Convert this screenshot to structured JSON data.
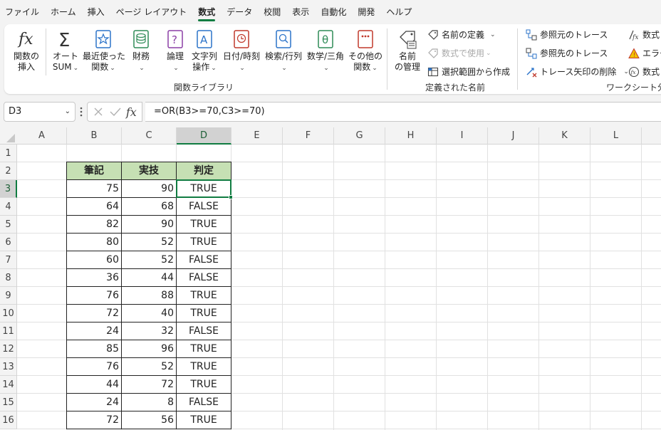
{
  "menu": {
    "tabs": [
      "ファイル",
      "ホーム",
      "挿入",
      "ページ レイアウト",
      "数式",
      "データ",
      "校閲",
      "表示",
      "自動化",
      "開発",
      "ヘルプ"
    ],
    "active_index": 4
  },
  "ribbon": {
    "function_library": {
      "insert_function": [
        "関数の",
        "挿入"
      ],
      "autosum": [
        "オート",
        "SUM"
      ],
      "recently_used": [
        "最近使った",
        "関数"
      ],
      "financial": [
        "財務"
      ],
      "logical": [
        "論理"
      ],
      "text": [
        "文字列",
        "操作"
      ],
      "datetime": [
        "日付/時刻"
      ],
      "lookup": [
        "検索/行列"
      ],
      "math": [
        "数学/三角"
      ],
      "more": [
        "その他の",
        "関数"
      ],
      "group_label": "関数ライブラリ"
    },
    "defined_names": {
      "name_manager": [
        "名前",
        "の管理"
      ],
      "define_name": "名前の定義",
      "use_in_formula": "数式で使用",
      "create_from_selection": "選択範囲から作成",
      "group_label": "定義された名前"
    },
    "formula_auditing": {
      "trace_precedents": "参照元のトレース",
      "trace_dependents": "参照先のトレース",
      "remove_arrows": "トレース矢印の削除",
      "show_formulas": "数式",
      "error_checking": "エラー",
      "evaluate_formula": "数式",
      "group_label": "ワークシート分析"
    }
  },
  "formula_bar": {
    "name_box": "D3",
    "formula": "=OR(B3>=70,C3>=70)",
    "fx_label": "fx"
  },
  "sheet": {
    "columns": [
      "A",
      "B",
      "C",
      "D",
      "E",
      "F",
      "G",
      "H",
      "I",
      "J",
      "K",
      "L"
    ],
    "selected_column": "D",
    "rows": [
      "1",
      "2",
      "3",
      "4",
      "5",
      "6",
      "7",
      "8",
      "9",
      "10",
      "11",
      "12",
      "13",
      "14",
      "15",
      "16"
    ],
    "selected_row": "3",
    "table_headers": [
      "筆記",
      "実技",
      "判定"
    ],
    "table_rows": [
      [
        "75",
        "90",
        "TRUE"
      ],
      [
        "64",
        "68",
        "FALSE"
      ],
      [
        "82",
        "90",
        "TRUE"
      ],
      [
        "80",
        "52",
        "TRUE"
      ],
      [
        "60",
        "52",
        "FALSE"
      ],
      [
        "36",
        "44",
        "FALSE"
      ],
      [
        "76",
        "88",
        "TRUE"
      ],
      [
        "72",
        "40",
        "TRUE"
      ],
      [
        "24",
        "32",
        "FALSE"
      ],
      [
        "85",
        "96",
        "TRUE"
      ],
      [
        "76",
        "52",
        "TRUE"
      ],
      [
        "44",
        "72",
        "TRUE"
      ],
      [
        "24",
        "8",
        "FALSE"
      ],
      [
        "72",
        "56",
        "TRUE"
      ]
    ]
  },
  "colors": {
    "accent": "#107c41",
    "header_fill": "#c6e0b4"
  }
}
